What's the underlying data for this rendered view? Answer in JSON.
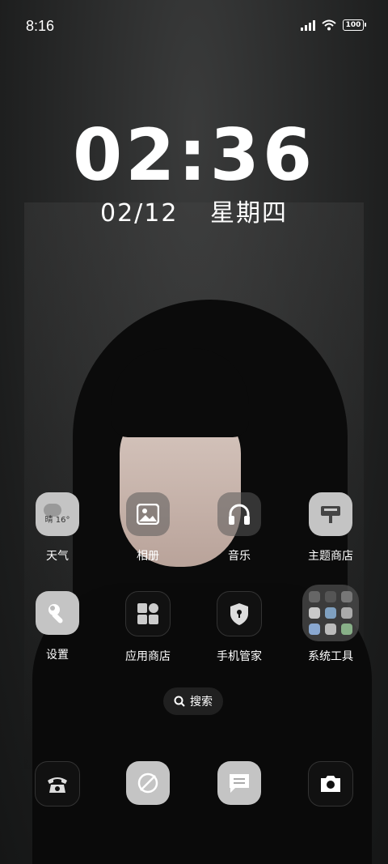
{
  "status": {
    "time": "8:16",
    "battery": "100"
  },
  "lockscreen": {
    "clock": "02:36",
    "date": "02/12",
    "weekday": "星期四"
  },
  "weather_widget_text": "晴 16°",
  "apps": [
    {
      "label": "天气",
      "icon": "weather-icon"
    },
    {
      "label": "相册",
      "icon": "gallery-icon"
    },
    {
      "label": "音乐",
      "icon": "headphones-icon"
    },
    {
      "label": "主题商店",
      "icon": "theme-store-icon"
    },
    {
      "label": "设置",
      "icon": "wrench-icon"
    },
    {
      "label": "应用商店",
      "icon": "app-store-icon"
    },
    {
      "label": "手机管家",
      "icon": "security-shield-icon"
    },
    {
      "label": "系统工具",
      "icon": "folder-icon"
    }
  ],
  "search": {
    "label": "搜索"
  },
  "dock": [
    {
      "icon": "phone-icon"
    },
    {
      "icon": "browser-icon"
    },
    {
      "icon": "messages-icon"
    },
    {
      "icon": "camera-icon"
    }
  ]
}
